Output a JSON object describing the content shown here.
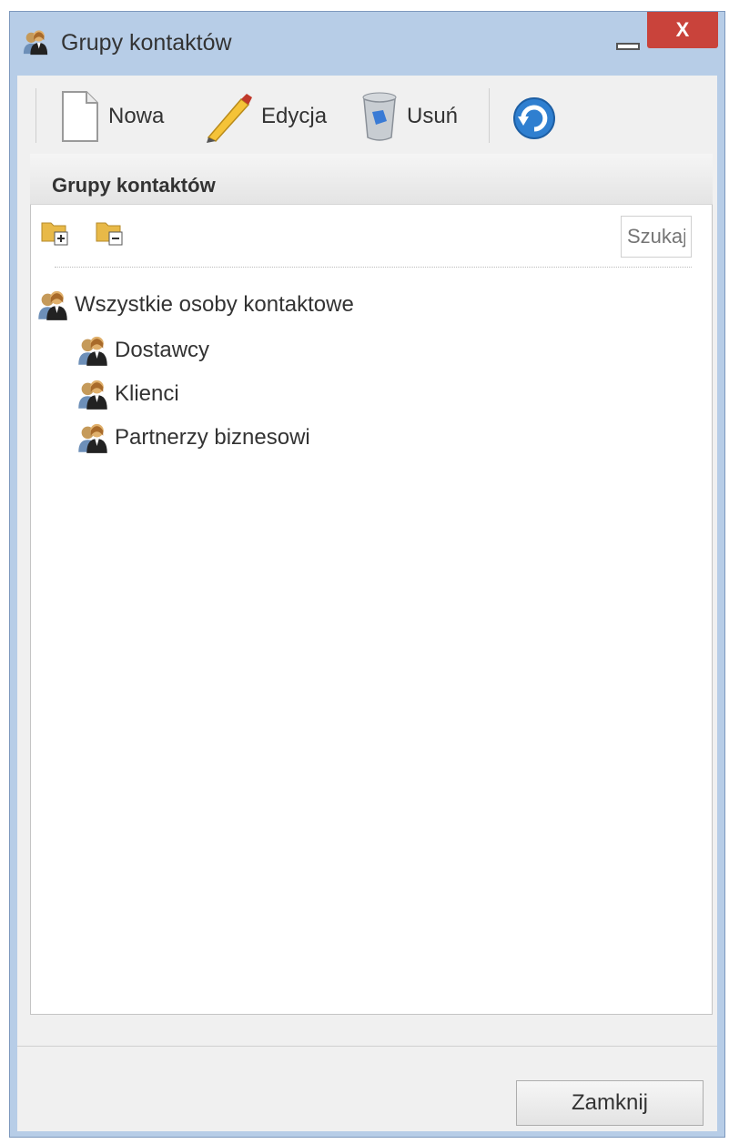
{
  "window": {
    "title": "Grupy kontaktów",
    "close_label": "X"
  },
  "toolbar": {
    "new_label": "Nowa",
    "edit_label": "Edycja",
    "delete_label": "Usuń"
  },
  "panel": {
    "header": "Grupy kontaktów",
    "search_placeholder": "Szukaj"
  },
  "tree": {
    "root": "Wszystkie osoby kontaktowe",
    "children": [
      "Dostawcy",
      "Klienci",
      "Partnerzy biznesowi"
    ]
  },
  "footer": {
    "close_button": "Zamknij"
  },
  "colors": {
    "window_frame": "#b7cde7",
    "close_button": "#c9433b",
    "client_bg": "#f0f0f0"
  },
  "icons": {
    "window": "contacts-group-icon",
    "new": "document-icon",
    "edit": "pencil-icon",
    "delete": "recycle-bin-icon",
    "refresh": "refresh-icon",
    "expand": "folder-expand-icon",
    "collapse": "folder-collapse-icon",
    "group": "contacts-group-icon"
  }
}
